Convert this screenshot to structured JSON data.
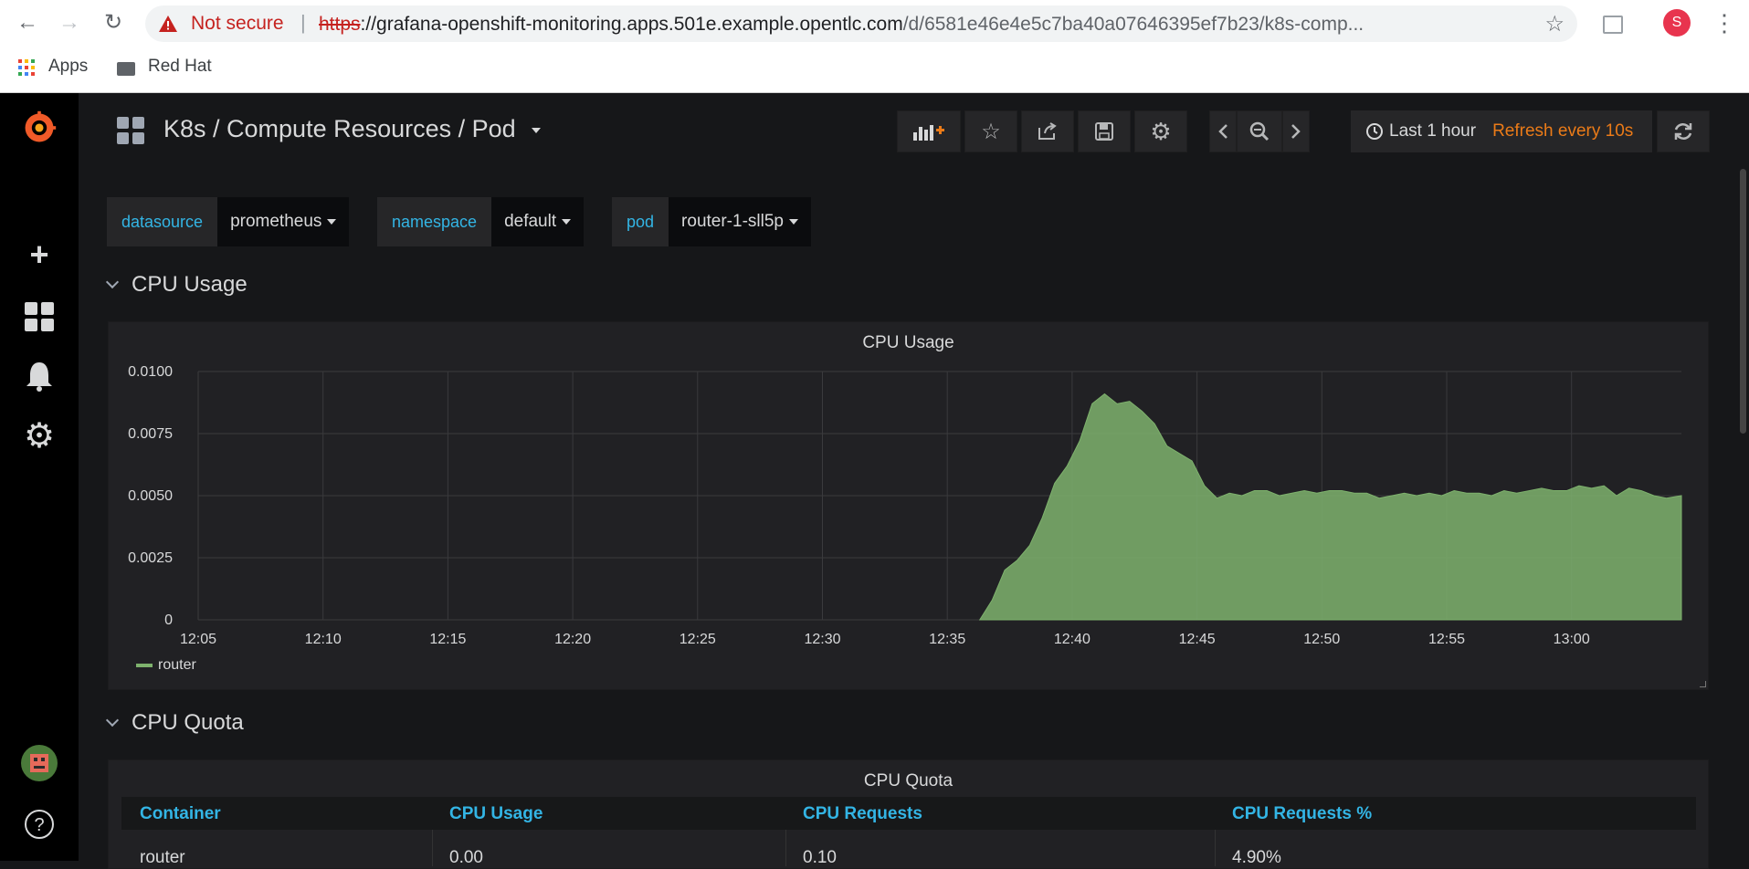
{
  "browser": {
    "security_label": "Not secure",
    "url_scheme": "https",
    "url_host": "://grafana-openshift-monitoring.apps.501e.example.opentlc.com",
    "url_path": "/d/6581e46e4e5c7ba40a07646395ef7b23/k8s-comp...",
    "profile_initial": "S",
    "bookmarks": [
      {
        "label": "Apps"
      },
      {
        "label": "Red Hat"
      }
    ]
  },
  "dashboard": {
    "title": "K8s / Compute Resources / Pod",
    "time_range": "Last 1 hour",
    "refresh": "Refresh every 10s"
  },
  "variables": [
    {
      "label": "datasource",
      "value": "prometheus"
    },
    {
      "label": "namespace",
      "value": "default"
    },
    {
      "label": "pod",
      "value": "router-1-sll5p"
    }
  ],
  "rows": [
    {
      "title": "CPU Usage"
    },
    {
      "title": "CPU Quota"
    }
  ],
  "cpu_panel": {
    "title": "CPU Usage",
    "legend": "router"
  },
  "chart_data": {
    "type": "area",
    "title": "CPU Usage",
    "y_ticks": [
      "0.0100",
      "0.0075",
      "0.0050",
      "0.0025",
      "0"
    ],
    "ylim": [
      0,
      0.01
    ],
    "x_ticks": [
      "12:05",
      "12:10",
      "12:15",
      "12:20",
      "12:25",
      "12:30",
      "12:35",
      "12:40",
      "12:45",
      "12:50",
      "12:55",
      "13:00"
    ],
    "xlim_minutes_past_noon": [
      5,
      64.4
    ],
    "color": "#7eb26d",
    "legend_position": "bottom-left",
    "series": [
      {
        "name": "router",
        "x": [
          36.3,
          36.8,
          37.3,
          37.8,
          38.3,
          38.8,
          39.3,
          39.8,
          40.3,
          40.8,
          41.3,
          41.8,
          42.3,
          42.8,
          43.3,
          43.8,
          44.3,
          44.8,
          45.3,
          45.8,
          46.3,
          46.8,
          47.3,
          47.8,
          48.3,
          48.8,
          49.3,
          49.8,
          50.3,
          50.8,
          51.3,
          51.8,
          52.3,
          52.8,
          53.3,
          53.8,
          54.3,
          54.8,
          55.3,
          55.8,
          56.3,
          56.8,
          57.3,
          57.8,
          58.3,
          58.8,
          59.3,
          59.8,
          60.3,
          60.8,
          61.3,
          61.8,
          62.3,
          62.8,
          63.3,
          63.8,
          64.4
        ],
        "y": [
          0,
          0.0008,
          0.002,
          0.0024,
          0.003,
          0.0041,
          0.0055,
          0.0062,
          0.0072,
          0.0087,
          0.0091,
          0.0087,
          0.0088,
          0.0084,
          0.0079,
          0.007,
          0.0067,
          0.0064,
          0.0054,
          0.0049,
          0.0051,
          0.005,
          0.0052,
          0.0052,
          0.005,
          0.0051,
          0.0052,
          0.0051,
          0.0052,
          0.0052,
          0.0051,
          0.0051,
          0.0049,
          0.005,
          0.0051,
          0.005,
          0.0051,
          0.005,
          0.0052,
          0.0051,
          0.0051,
          0.005,
          0.0052,
          0.0051,
          0.0052,
          0.0053,
          0.0052,
          0.0052,
          0.0054,
          0.0053,
          0.0054,
          0.005,
          0.0053,
          0.0052,
          0.005,
          0.0049,
          0.005
        ]
      }
    ]
  },
  "quota_panel": {
    "title": "CPU Quota",
    "columns": [
      "Container",
      "CPU Usage",
      "CPU Requests",
      "CPU Requests %"
    ],
    "rows": [
      [
        "router",
        "0.00",
        "0.10",
        "4.90%"
      ]
    ]
  }
}
